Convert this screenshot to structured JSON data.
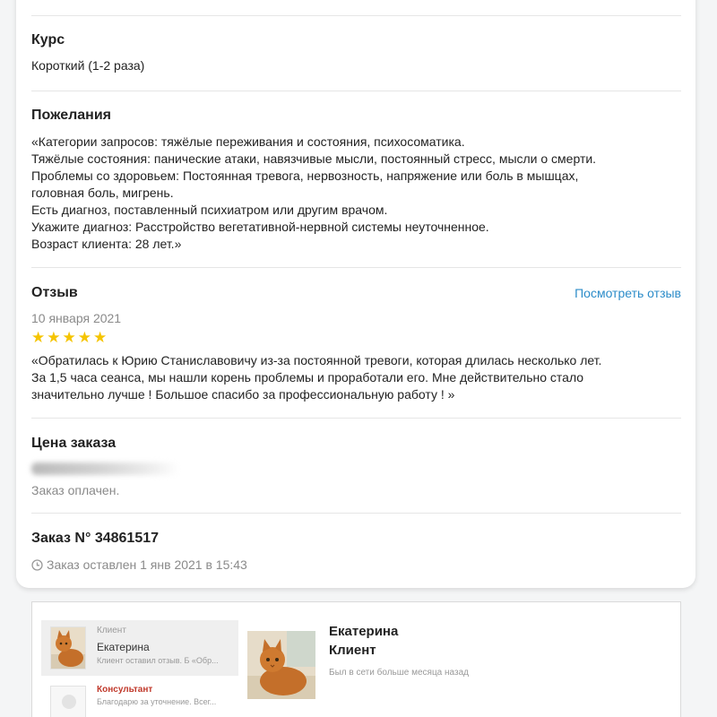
{
  "course": {
    "title": "Курс",
    "value": "Короткий (1-2 раза)"
  },
  "wishes": {
    "title": "Пожелания",
    "lines": [
      "«Категории запросов: тяжёлые переживания и состояния, психосоматика.",
      "Тяжёлые состояния: панические атаки, навязчивые мысли, постоянный стресс, мысли о смерти.",
      "Проблемы со здоровьем: Постоянная тревога, нервозность, напряжение или боль в мышцах,",
      "головная боль, мигрень.",
      "Есть диагноз, поставленный психиатром или другим врачом.",
      "Укажите диагноз: Расстройство вегетативной-нервной системы неуточненное.",
      "Возраст клиента: 28 лет.»"
    ]
  },
  "review": {
    "title": "Отзыв",
    "view_link": "Посмотреть отзыв",
    "date": "10 января 2021",
    "rating": 5,
    "lines": [
      "«Обратилась к Юрию Станиславовичу из-за постоянной тревоги, которая длилась несколько лет.",
      "За 1,5 часа сеанса, мы нашли корень проблемы и проработали его. Мне действительно стало",
      "значительно лучше ! Большое спасибо за профессиональную работу ! »"
    ]
  },
  "price": {
    "title": "Цена заказа",
    "status": "Заказ оплачен."
  },
  "order": {
    "title": "Заказ N° 34861517",
    "placed": "Заказ оставлен 1 янв 2021 в 15:43"
  },
  "chat": {
    "conversations": [
      {
        "role": "Клиент",
        "name": "Екатерина",
        "snippet": "Клиент оставил отзыв. Б «Обр..."
      },
      {
        "role": "Консультант",
        "name": "",
        "snippet": "Благодарю за уточнение. Всег..."
      }
    ],
    "header": {
      "name_line1": "Екатерина",
      "name_line2": "Клиент",
      "last_seen": "Был в сети больше месяца назад"
    }
  },
  "colors": {
    "link": "#2c8cc9",
    "star": "#f5c400",
    "consultant": "#c0392b"
  }
}
